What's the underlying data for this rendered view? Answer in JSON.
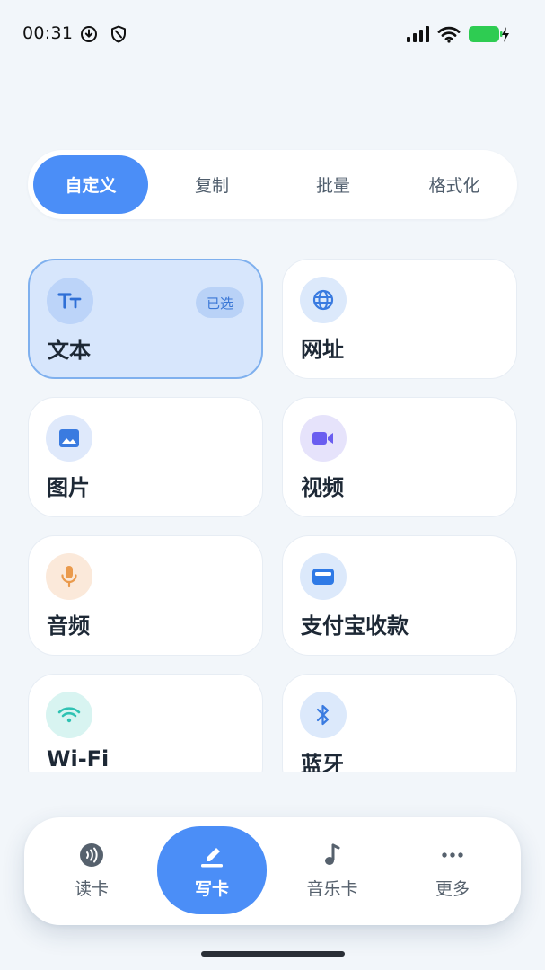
{
  "status_bar": {
    "time": "00:31"
  },
  "tabs": [
    {
      "label": "自定义",
      "active": true
    },
    {
      "label": "复制",
      "active": false
    },
    {
      "label": "批量",
      "active": false
    },
    {
      "label": "格式化",
      "active": false
    }
  ],
  "cards": [
    {
      "label": "文本",
      "icon": "text-size-icon",
      "selected": true,
      "badge": "已选",
      "icon_bg": "#bcd4f9",
      "icon_color": "#2f6fd6"
    },
    {
      "label": "网址",
      "icon": "globe-icon",
      "selected": false,
      "icon_bg": "#dce9fb",
      "icon_color": "#3a7be0"
    },
    {
      "label": "图片",
      "icon": "image-icon",
      "selected": false,
      "icon_bg": "#dfe9fb",
      "icon_color": "#3a7be0"
    },
    {
      "label": "视频",
      "icon": "video-icon",
      "selected": false,
      "icon_bg": "#e6e3fb",
      "icon_color": "#6a5ef0"
    },
    {
      "label": "音频",
      "icon": "microphone-icon",
      "selected": false,
      "icon_bg": "#fbe9da",
      "icon_color": "#ea9a4c"
    },
    {
      "label": "支付宝收款",
      "icon": "wallet-icon",
      "selected": false,
      "icon_bg": "#dce9fb",
      "icon_color": "#2f7ae6"
    },
    {
      "label": "Wi-Fi",
      "icon": "wifi-icon",
      "selected": false,
      "icon_bg": "#d8f4f1",
      "icon_color": "#2fc2b3"
    },
    {
      "label": "蓝牙",
      "icon": "bluetooth-icon",
      "selected": false,
      "icon_bg": "#dce9fb",
      "icon_color": "#3a7be0"
    }
  ],
  "bottom_nav": [
    {
      "label": "读卡",
      "icon": "nfc-read-icon",
      "active": false
    },
    {
      "label": "写卡",
      "icon": "pencil-write-icon",
      "active": true
    },
    {
      "label": "音乐卡",
      "icon": "music-note-icon",
      "active": false
    },
    {
      "label": "更多",
      "icon": "more-dots-icon",
      "active": false
    }
  ],
  "colors": {
    "accent": "#4b8ef7",
    "background": "#f2f6fa",
    "selected_card": "#d7e6fc",
    "battery": "#2ecc52"
  }
}
